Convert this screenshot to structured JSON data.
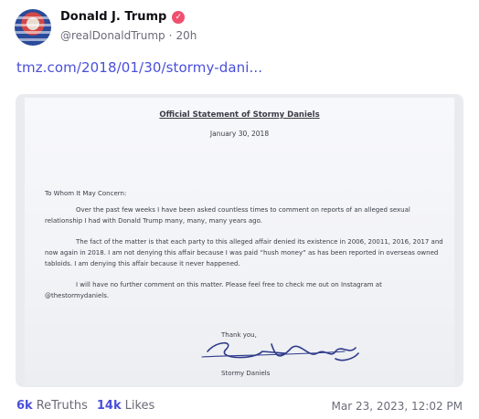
{
  "post": {
    "author": {
      "display_name": "Donald J. Trump",
      "handle": "@realDonaldTrump",
      "separator": "·",
      "age": "20h",
      "verified_icon": "verified-badge-icon",
      "brand_color": "#f0506e"
    },
    "link_text": "tmz.com/2018/01/30/stormy-dani...",
    "link_color": "#4a4fd8",
    "media": {
      "doc_title": "Official Statement of Stormy Daniels",
      "doc_date": "January 30, 2018",
      "salutation": "To Whom It May Concern:",
      "para1": "Over the past few weeks I have been asked countless times to comment on reports of an alleged sexual relationship I had with Donald Trump many, many, many years ago.",
      "para2": "The fact of the matter is that each party to this alleged affair denied its existence in 2006, 20011, 2016, 2017 and now again in 2018. I am not denying this affair because I was paid “hush money” as has been reported in overseas owned tabloids. I am denying this affair because it never happened.",
      "para3": "I will have no further comment on this matter. Please feel free to check me out on Instagram at @thestormydaniels.",
      "closing": "Thank you,",
      "signature": "Stormy Daniels",
      "signer": "Stormy Daniels"
    },
    "stats": {
      "retruths_count": "6k",
      "retruths_label": "ReTruths",
      "likes_count": "14k",
      "likes_label": "Likes"
    },
    "timestamp": "Mar 23, 2023, 12:02 PM"
  }
}
